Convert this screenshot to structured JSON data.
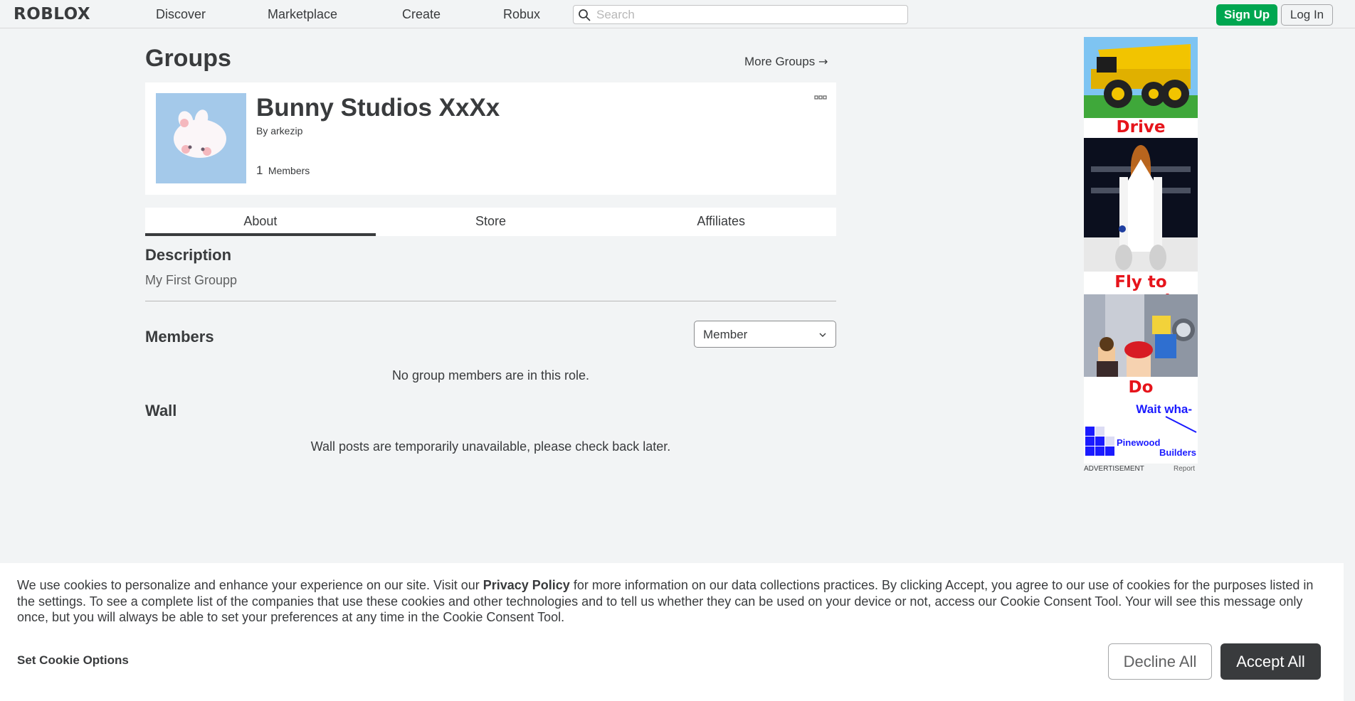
{
  "header": {
    "logo_text": "ROBLOX",
    "nav": [
      "Discover",
      "Marketplace",
      "Create",
      "Robux"
    ],
    "search_placeholder": "Search",
    "signup_label": "Sign Up",
    "login_label": "Log In"
  },
  "page": {
    "title": "Groups",
    "more_groups_label": "More Groups",
    "more_groups_arrow": "→"
  },
  "group": {
    "name": "Bunny Studios XxXx",
    "by_label": "By",
    "owner": "arkezip",
    "member_count": "1",
    "member_label": "Members"
  },
  "tabs": [
    "About",
    "Store",
    "Affiliates"
  ],
  "about": {
    "description_title": "Description",
    "description": "My First Groupp",
    "members_title": "Members",
    "role_selected": "Member",
    "no_members_message": "No group members are in this role.",
    "wall_title": "Wall",
    "wall_message": "Wall posts are temporarily unavailable, please check back later."
  },
  "ad": {
    "captions": [
      "Drive beasts!",
      "Fly to space!",
      "Do laundry!!"
    ],
    "tagline": "Wait wha-",
    "brand_line1": "Pinewood",
    "brand_line2": "Builders",
    "label": "ADVERTISEMENT",
    "report": "Report"
  },
  "cookie": {
    "text_before": "We use cookies to personalize and enhance your experience on our site. Visit our ",
    "privacy_link": "Privacy Policy",
    "text_after": " for more information on our data collections practices. By clicking Accept, you agree to our use of cookies for the purposes listed in the settings. To see a complete list of the companies that use these cookies and other technologies and to tell us whether they can be used on your device or not, access our Cookie Consent Tool. Your will see this message only once, but you will always be able to set your preferences at any time in the Cookie Consent Tool.",
    "options_label": "Set Cookie Options",
    "decline_label": "Decline All",
    "accept_label": "Accept All"
  },
  "colors": {
    "signup_green": "#00a650",
    "background": "#f2f4f5",
    "text": "#393b3d",
    "ad_red": "#e6141b",
    "ad_blue": "#1a1aff"
  }
}
